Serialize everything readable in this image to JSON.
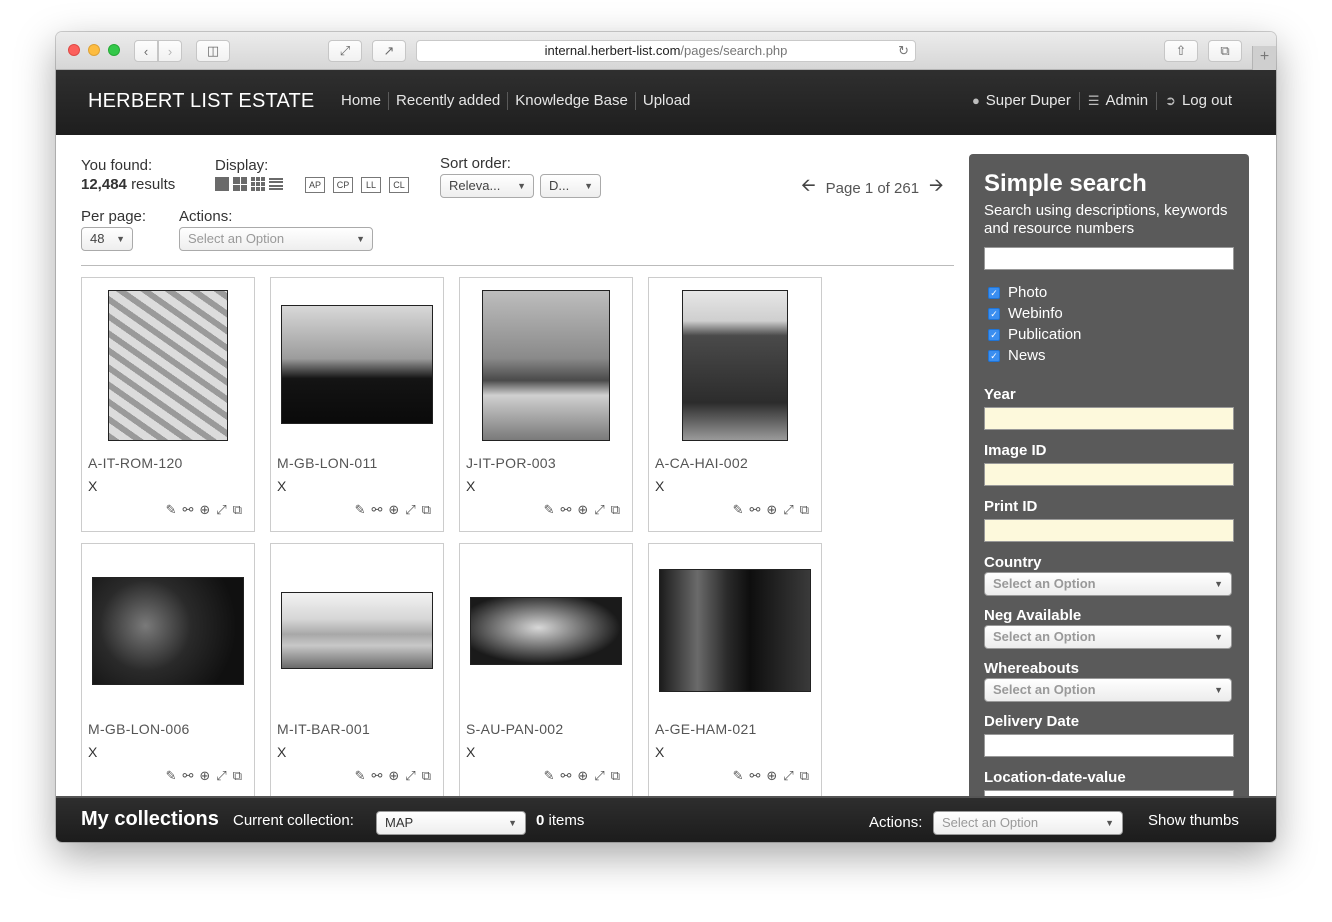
{
  "browser": {
    "url_host": "internal.herbert-list.com",
    "url_path": "/pages/search.php"
  },
  "header": {
    "brand": "HERBERT LIST ESTATE",
    "nav": [
      "Home",
      "Recently added",
      "Knowledge Base",
      "Upload"
    ],
    "user": "Super Duper",
    "admin": "Admin",
    "logout": "Log out"
  },
  "toolbar": {
    "found_label": "You found:",
    "found_count": "12,484",
    "found_suffix": "results",
    "display_label": "Display:",
    "display_tags": [
      "AP",
      "CP",
      "LL",
      "CL"
    ],
    "sort_label": "Sort order:",
    "sort_field": "Releva...",
    "sort_dir": "D...",
    "per_page_label": "Per page:",
    "per_page_value": "48",
    "actions_label": "Actions:",
    "actions_placeholder": "Select an Option",
    "page_text": "Page 1 of 261"
  },
  "results": [
    {
      "id": "A-IT-ROM-120",
      "x": "X"
    },
    {
      "id": "M-GB-LON-011",
      "x": "X"
    },
    {
      "id": "J-IT-POR-003",
      "x": "X"
    },
    {
      "id": "A-CA-HAI-002",
      "x": "X"
    },
    {
      "id": "M-GB-LON-006",
      "x": "X"
    },
    {
      "id": "M-IT-BAR-001",
      "x": "X"
    },
    {
      "id": "S-AU-PAN-002",
      "x": "X"
    },
    {
      "id": "A-GE-HAM-021",
      "x": "X"
    }
  ],
  "sidebar": {
    "title": "Simple search",
    "subtitle": "Search using descriptions, keywords and resource numbers",
    "checkboxes": [
      "Photo",
      "Webinfo",
      "Publication",
      "News"
    ],
    "year_label": "Year",
    "image_id_label": "Image ID",
    "print_id_label": "Print ID",
    "country_label": "Country",
    "neg_label": "Neg Available",
    "whereabouts_label": "Whereabouts",
    "delivery_label": "Delivery Date",
    "location_label": "Location-date-value",
    "select_placeholder": "Select an Option"
  },
  "collections": {
    "title": "My collections",
    "current_label": "Current collection:",
    "current_value": "MAP",
    "items_count": "0",
    "items_suffix": "items",
    "actions_label": "Actions:",
    "actions_placeholder": "Select an Option",
    "show_thumbs": "Show thumbs"
  }
}
